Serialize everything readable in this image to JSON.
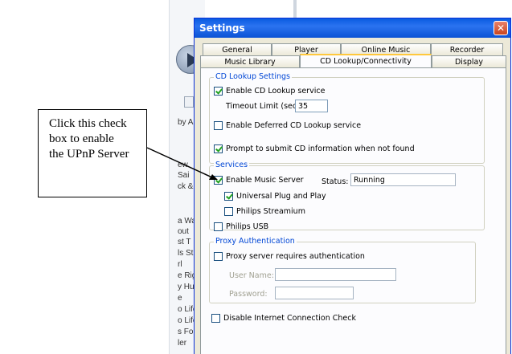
{
  "background_app": {
    "fragments": [
      "by A",
      "ew",
      "Sai",
      "ck &",
      "a Wa",
      "out",
      "st T",
      "ls St",
      "rl",
      "e Rig",
      "y Hu",
      "e",
      "o Life",
      "o Life",
      "s Fo",
      "ler"
    ]
  },
  "callout": {
    "lines": [
      "Click this check",
      "box to enable",
      "the UPnP Server"
    ]
  },
  "dialog": {
    "title": "Settings",
    "close_glyph": "✕",
    "tabs_row1": [
      "General",
      "Player",
      "Online Music",
      "Recorder"
    ],
    "tabs_row2": [
      "Music Library",
      "CD Lookup/Connectivity",
      "Display"
    ],
    "active_tab": "CD Lookup/Connectivity"
  },
  "cd_lookup": {
    "group_title": "CD Lookup Settings",
    "enable_cd_lookup": {
      "label": "Enable CD Lookup service",
      "checked": true
    },
    "timeout_label": "Timeout Limit (sec):",
    "timeout_value": "35",
    "enable_deferred": {
      "label": "Enable Deferred CD Lookup service",
      "checked": false
    },
    "prompt_submit": {
      "label": "Prompt to submit CD information when not found",
      "checked": true
    }
  },
  "services": {
    "group_title": "Services",
    "enable_music_server": {
      "label": "Enable Music Server",
      "checked": true
    },
    "status_label": "Status:",
    "status_value": "Running",
    "upnp": {
      "label": "Universal Plug and Play",
      "checked": true
    },
    "philips_streamium": {
      "label": "Philips Streamium",
      "checked": false
    },
    "philips_usb": {
      "label": "Philips USB",
      "checked": false
    }
  },
  "proxy": {
    "group_title": "Proxy Authentication",
    "requires_auth": {
      "label": "Proxy server requires authentication",
      "checked": false
    },
    "username_label": "User Name:",
    "username_value": "",
    "password_label": "Password:",
    "password_value": ""
  },
  "disable_internet_check": {
    "label": "Disable Internet Connection Check",
    "checked": false
  },
  "colors": {
    "titlebar": "#0a5be0",
    "group_title": "#0046d5",
    "checkmark": "#21a121",
    "close_button": "#c8451f"
  }
}
